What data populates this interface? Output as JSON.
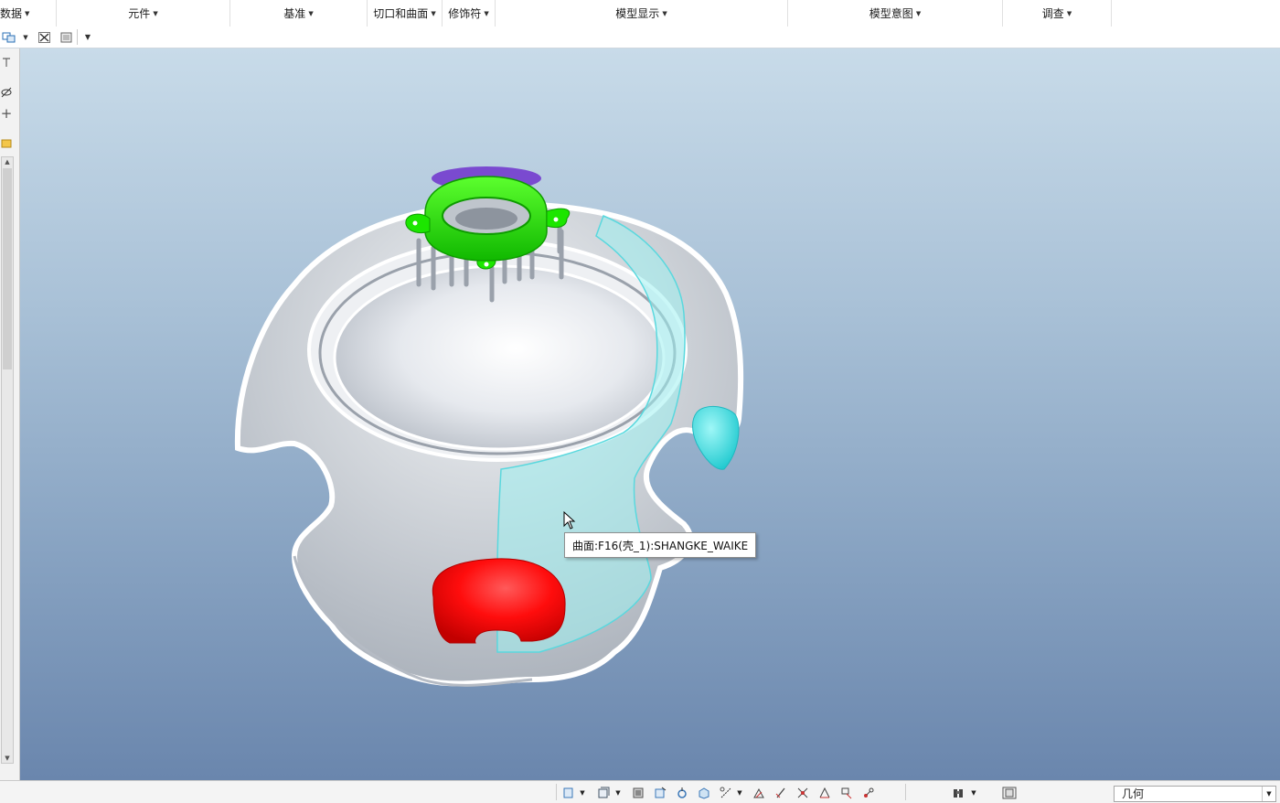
{
  "ribbon": {
    "groups": [
      {
        "label": "数据"
      },
      {
        "label": "元件"
      },
      {
        "label": "基准"
      },
      {
        "label": "切口和曲面"
      },
      {
        "label": "修饰符"
      },
      {
        "label": "模型显示"
      },
      {
        "label": "模型意图"
      },
      {
        "label": "调查"
      }
    ]
  },
  "viewport": {
    "tooltip": "曲面:F16(壳_1):SHANGKE_WAIKE",
    "colors": {
      "shell": "#e9ecef",
      "ring_part": "#18e000",
      "red_part": "#ff1010",
      "cyan_part": "#3ee6e6",
      "highlight_surface": "#9ff0f0",
      "purple_cap": "#7a4ad0"
    }
  },
  "status_bar": {
    "filter_value": "几何"
  },
  "icons": {
    "quick_toolbar": [
      "select-icon",
      "dropdown-icon",
      "close-window-icon",
      "screen-icon",
      "overflow-icon"
    ],
    "left_panel": [
      "label-icon",
      "visibility-icon",
      "add-icon",
      "folder-icon"
    ],
    "status_bar": [
      "part-icon",
      "part-dropdown-icon",
      "layer-icon",
      "assemble-icon",
      "move-icon",
      "rotate-icon",
      "appearance-icon",
      "constraint-icon",
      "orient-icon",
      "flip-icon",
      "align-icon",
      "snap-icon",
      "layout-icon",
      "link-icon",
      "binoculars-icon",
      "fullscreen-icon"
    ]
  }
}
